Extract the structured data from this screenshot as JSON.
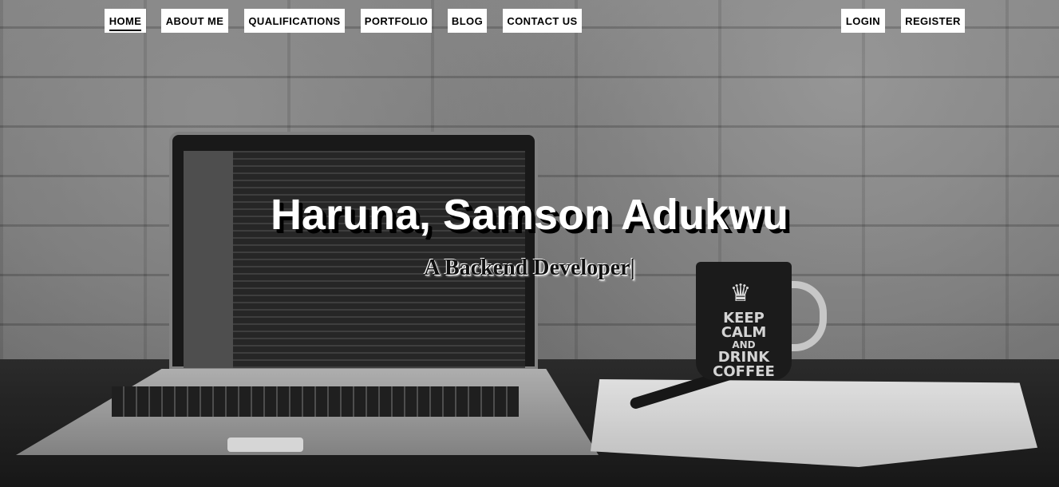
{
  "nav": {
    "left": [
      {
        "label": "HOME",
        "active": true
      },
      {
        "label": "ABOUT ME"
      },
      {
        "label": "QUALIFICATIONS"
      },
      {
        "label": "PORTFOLIO"
      },
      {
        "label": "BLOG"
      },
      {
        "label": "CONTACT US"
      }
    ],
    "right": [
      {
        "label": "LOGIN"
      },
      {
        "label": "REGISTER"
      }
    ]
  },
  "hero": {
    "title": "Haruna, Samson Adukwu",
    "subtitle": "A Backend Developer|",
    "mug": {
      "line1": "KEEP",
      "line2": "CALM",
      "line3": "AND",
      "line4": "DRINK",
      "line5": "COFFEE"
    }
  },
  "colors": {
    "nav_bg": "#ffffff",
    "nav_text": "#000000",
    "title": "#ffffff",
    "subtitle": "#111111"
  }
}
